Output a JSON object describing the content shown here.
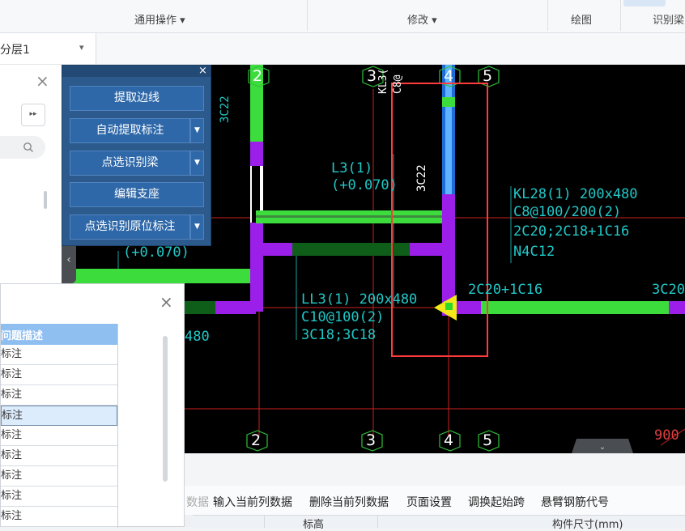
{
  "ribbon": {
    "groups": [
      "通用操作 ▾",
      "修改 ▾",
      "绘图",
      "识别梁"
    ]
  },
  "floor": {
    "selected": "分层1",
    "arrow": "▾"
  },
  "left_panel": {
    "close": "×",
    "expand": "▸▸",
    "collapse": "‹"
  },
  "tool_window": {
    "close": "×",
    "buttons": [
      "提取边线",
      "自动提取标注",
      "点选识别梁",
      "编辑支座",
      "点选识别原位标注"
    ],
    "dropdown_arrow": "▼"
  },
  "list_window": {
    "close": "×",
    "header": "问题描述",
    "rows": [
      "标注",
      "标注",
      "标注",
      "标注",
      "标注",
      "标注",
      "标注",
      "标注",
      "标注"
    ],
    "selected_index": 3
  },
  "bottom_toolbar": {
    "items": [
      "数据",
      "输入当前列数据",
      "删除当前列数据",
      "页面设置",
      "调换起始跨",
      "悬臂钢筋代号"
    ],
    "table_headers": [
      "标高",
      "构件尺寸(mm)"
    ]
  },
  "canvas": {
    "axis_top": [
      "2",
      "3",
      "4",
      "5"
    ],
    "axis_bottom": [
      "2",
      "3",
      "4",
      "5"
    ],
    "texts": {
      "c3c22_left": "3C22",
      "l3_line1": "L3(1)",
      "l3_line2": "(+0.070)",
      "kl_v1": "KL3(",
      "kl_v2": "C8@",
      "c3c22_mid": "3C22",
      "kl28_1": "KL28(1) 200x480",
      "kl28_2": "C8@100/200(2)",
      "kl28_3": "2C20;2C18+1C16",
      "kl28_4": "N4C12",
      "plus070": "(+0.070)",
      "ll3_1": "LL3(1) 200x480",
      "ll3_2": "C10@100(2)",
      "ll3_3": "3C18;3C18",
      "c480": "480",
      "c2c20": "2C20+1C16",
      "c3c20": "3C20",
      "c900": "900"
    }
  },
  "colors": {
    "beam_green": "#3ddc3d",
    "beam_purple": "#9b1fe8",
    "dark_green": "#0e5e1a",
    "annotation_cyan": "#21c8c8",
    "grid_red": "#cc2020",
    "select_box": "#ff3b3b"
  }
}
